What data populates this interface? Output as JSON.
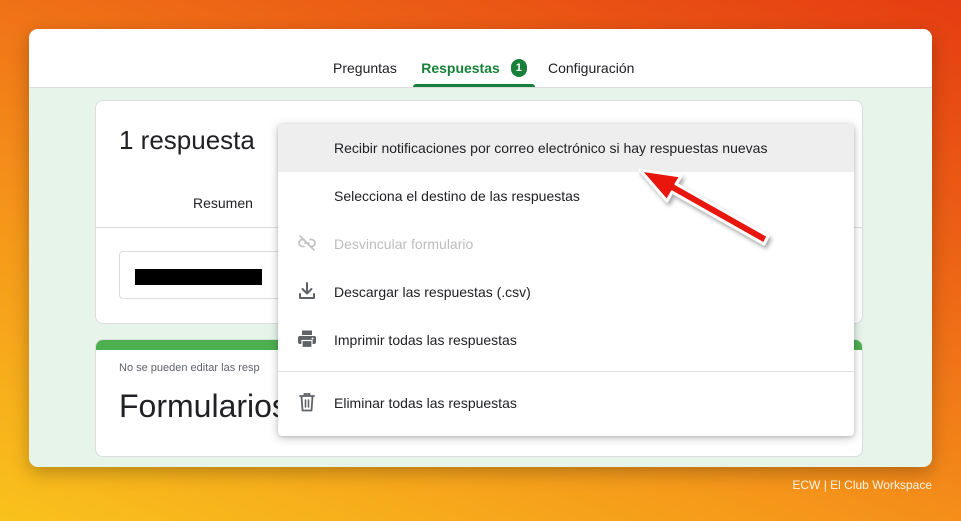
{
  "tabs": {
    "preguntas": "Preguntas",
    "respuestas": "Respuestas",
    "respuestas_badge": "1",
    "configuracion": "Configuración"
  },
  "summary_card": {
    "response_count": "1 respuesta",
    "subtab_label": "Resumen"
  },
  "form_card": {
    "note": "No se pueden editar las resp",
    "title": "Formularios"
  },
  "menu": {
    "items": [
      {
        "label": "Recibir notificaciones por correo electrónico si hay respuestas nuevas",
        "icon": "none",
        "state": "highlighted"
      },
      {
        "label": "Selecciona el destino de las respuestas",
        "icon": "none",
        "state": "enabled"
      },
      {
        "label": "Desvincular formulario",
        "icon": "link-off-icon",
        "state": "disabled"
      },
      {
        "label": "Descargar las respuestas (.csv)",
        "icon": "download-icon",
        "state": "enabled"
      },
      {
        "label": "Imprimir todas las respuestas",
        "icon": "print-icon",
        "state": "enabled"
      },
      {
        "label": "Eliminar todas las respuestas",
        "icon": "trash-icon",
        "state": "enabled"
      }
    ]
  },
  "annotation": {
    "arrow_color": "#e8140c",
    "points_to": "Recibir notificaciones por correo electrónico si hay respuestas nuevas"
  },
  "watermark": "ECW | El Club Workspace",
  "colors": {
    "accent_green": "#188038",
    "header_bar_green": "#4caf50",
    "page_tint": "#e6f4ea"
  }
}
